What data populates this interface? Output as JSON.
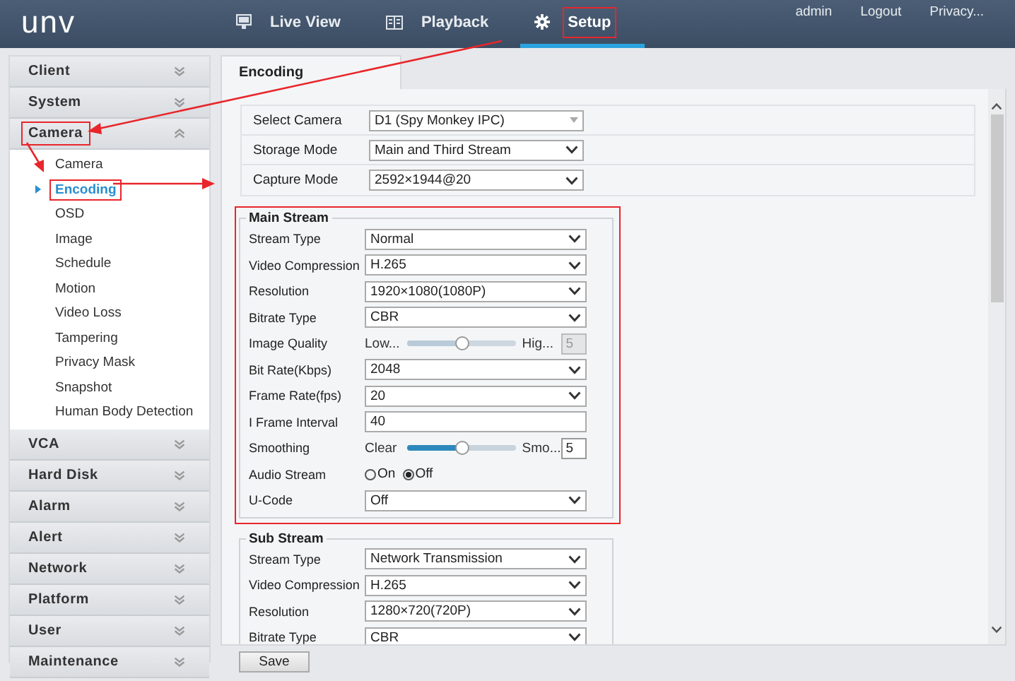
{
  "header": {
    "logo": "unv",
    "nav": [
      {
        "label": "Live View",
        "selected": false,
        "highlighted": false
      },
      {
        "label": "Playback",
        "selected": false,
        "highlighted": false
      },
      {
        "label": "Setup",
        "selected": true,
        "highlighted": true
      }
    ],
    "user_links": [
      "admin",
      "Logout",
      "Privacy..."
    ]
  },
  "sidebar": {
    "sections": [
      {
        "label": "Client",
        "expanded": false,
        "highlighted": false
      },
      {
        "label": "System",
        "expanded": false,
        "highlighted": false
      },
      {
        "label": "Camera",
        "expanded": true,
        "highlighted": true,
        "items": [
          {
            "label": "Camera",
            "selected": false,
            "highlighted": false
          },
          {
            "label": "Encoding",
            "selected": true,
            "highlighted": true
          },
          {
            "label": "OSD",
            "selected": false,
            "highlighted": false
          },
          {
            "label": "Image",
            "selected": false,
            "highlighted": false
          },
          {
            "label": "Schedule",
            "selected": false,
            "highlighted": false
          },
          {
            "label": "Motion",
            "selected": false,
            "highlighted": false
          },
          {
            "label": "Video Loss",
            "selected": false,
            "highlighted": false
          },
          {
            "label": "Tampering",
            "selected": false,
            "highlighted": false
          },
          {
            "label": "Privacy Mask",
            "selected": false,
            "highlighted": false
          },
          {
            "label": "Snapshot",
            "selected": false,
            "highlighted": false
          },
          {
            "label": "Human Body Detection",
            "selected": false,
            "highlighted": false
          }
        ]
      },
      {
        "label": "VCA",
        "expanded": false,
        "highlighted": false
      },
      {
        "label": "Hard Disk",
        "expanded": false,
        "highlighted": false
      },
      {
        "label": "Alarm",
        "expanded": false,
        "highlighted": false
      },
      {
        "label": "Alert",
        "expanded": false,
        "highlighted": false
      },
      {
        "label": "Network",
        "expanded": false,
        "highlighted": false
      },
      {
        "label": "Platform",
        "expanded": false,
        "highlighted": false
      },
      {
        "label": "User",
        "expanded": false,
        "highlighted": false
      },
      {
        "label": "Maintenance",
        "expanded": false,
        "highlighted": false
      }
    ]
  },
  "main": {
    "tab": "Encoding",
    "settings": [
      {
        "label": "Select Camera",
        "kind": "combo",
        "value": "D1 (Spy Monkey IPC)"
      },
      {
        "label": "Storage Mode",
        "kind": "select",
        "value": "Main and Third Stream"
      },
      {
        "label": "Capture Mode",
        "kind": "select",
        "value": "2592×1944@20"
      }
    ],
    "main_stream": {
      "title": "Main Stream",
      "highlighted": true,
      "rows": [
        {
          "label": "Stream Type",
          "kind": "select",
          "value": "Normal"
        },
        {
          "label": "Video Compression",
          "kind": "select",
          "value": "H.265"
        },
        {
          "label": "Resolution",
          "kind": "select",
          "value": "1920×1080(1080P)"
        },
        {
          "label": "Bitrate Type",
          "kind": "select",
          "value": "CBR"
        },
        {
          "label": "Image Quality",
          "kind": "slider",
          "min_label": "Low...",
          "max_label": "Hig...",
          "level": 0.5,
          "value": "5",
          "disabled": true
        },
        {
          "label": "Bit Rate(Kbps)",
          "kind": "select",
          "value": "2048"
        },
        {
          "label": "Frame Rate(fps)",
          "kind": "select",
          "value": "20"
        },
        {
          "label": "I Frame Interval",
          "kind": "input",
          "value": "40"
        },
        {
          "label": "Smoothing",
          "kind": "slider",
          "min_label": "Clear",
          "max_label": "Smo...",
          "level": 0.5,
          "value": "5",
          "disabled": false
        },
        {
          "label": "Audio Stream",
          "kind": "radio",
          "options": [
            {
              "label": "On",
              "selected": false
            },
            {
              "label": "Off",
              "selected": true
            }
          ]
        },
        {
          "label": "U-Code",
          "kind": "select",
          "value": "Off"
        }
      ]
    },
    "sub_stream": {
      "title": "Sub Stream",
      "highlighted": false,
      "rows": [
        {
          "label": "Stream Type",
          "kind": "select",
          "value": "Network Transmission"
        },
        {
          "label": "Video Compression",
          "kind": "select",
          "value": "H.265"
        },
        {
          "label": "Resolution",
          "kind": "select",
          "value": "1280×720(720P)"
        },
        {
          "label": "Bitrate Type",
          "kind": "select",
          "value": "CBR"
        }
      ]
    },
    "save_button": "Save"
  }
}
